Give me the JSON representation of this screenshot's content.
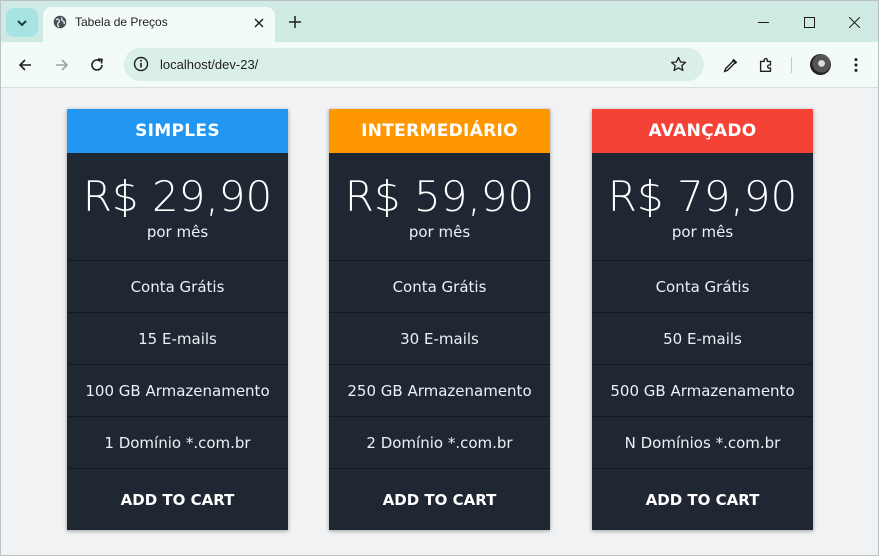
{
  "browser": {
    "tab_title": "Tabela de Preços",
    "url": "localhost/dev-23/"
  },
  "plans": [
    {
      "name": "SIMPLES",
      "color": "#2196f3",
      "price": "R$ 29,90",
      "period": "por mês",
      "features": [
        "Conta Grátis",
        "15 E-mails",
        "100 GB Armazenamento",
        "1 Domínio *.com.br"
      ],
      "cta": "ADD TO CART"
    },
    {
      "name": "INTERMEDIÁRIO",
      "color": "#ff9800",
      "price": "R$ 59,90",
      "period": "por mês",
      "features": [
        "Conta Grátis",
        "30 E-mails",
        "250 GB Armazenamento",
        "2 Domínio *.com.br"
      ],
      "cta": "ADD TO CART"
    },
    {
      "name": "AVANÇADO",
      "color": "#f44336",
      "price": "R$ 79,90",
      "period": "por mês",
      "features": [
        "Conta Grátis",
        "50 E-mails",
        "500 GB Armazenamento",
        "N Domínios *.com.br"
      ],
      "cta": "ADD TO CART"
    }
  ],
  "icons": {
    "tab_search": "chevron-down-icon",
    "favicon": "globe-icon",
    "close": "close-icon",
    "new_tab": "plus-icon",
    "back": "arrow-left-icon",
    "forward": "arrow-right-icon",
    "reload": "reload-icon",
    "site_info": "info-icon",
    "bookmark": "star-icon",
    "eyedropper": "eyedropper-icon",
    "extensions": "puzzle-icon",
    "menu": "kebab-menu-icon"
  }
}
